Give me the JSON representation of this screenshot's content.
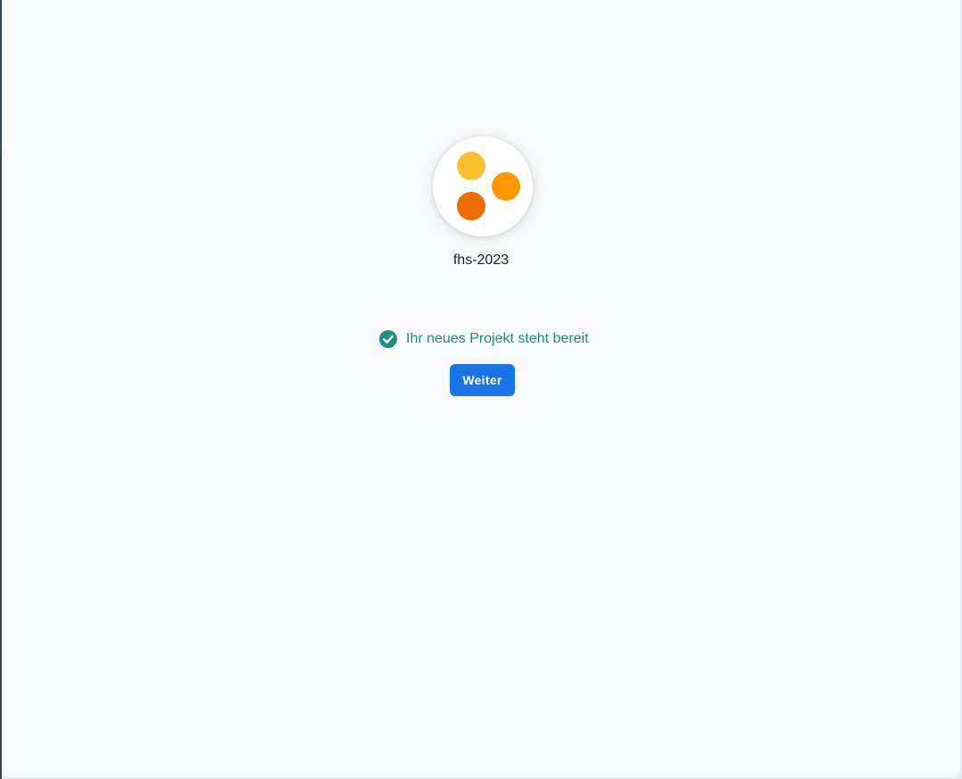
{
  "project": {
    "name": "fhs-2023",
    "avatar_icon": "three-dots-logo-icon",
    "avatar_colors": [
      "#fbc02d",
      "#ff9800",
      "#ef6c00"
    ]
  },
  "status": {
    "icon": "check-circle-icon",
    "text": "Ihr neues Projekt steht bereit",
    "color": "#1e8e7e"
  },
  "actions": {
    "continue_label": "Weiter",
    "accent": "#1a73e8"
  }
}
